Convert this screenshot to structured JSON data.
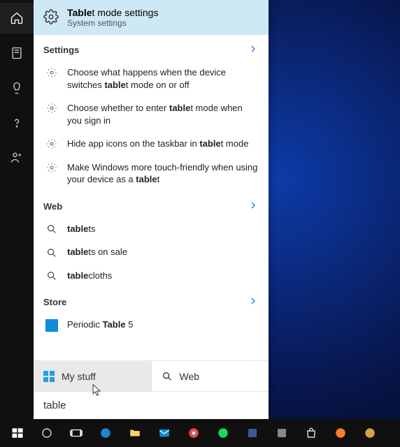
{
  "query": "table",
  "best_match": {
    "title_pre": "Table",
    "title_post": "t mode settings",
    "subtitle": "System settings"
  },
  "sections": {
    "settings": {
      "label": "Settings",
      "items": [
        {
          "pre": "Choose what happens when the device switches ",
          "bold": "table",
          "post": "t mode on or off"
        },
        {
          "pre": "Choose whether to enter ",
          "bold": "table",
          "post": "t mode when you sign in"
        },
        {
          "pre": "Hide app icons on the taskbar in ",
          "bold": "table",
          "post": "t mode"
        },
        {
          "pre": "Make Windows more touch-friendly when using your device as a ",
          "bold": "table",
          "post": "t"
        }
      ]
    },
    "web": {
      "label": "Web",
      "items": [
        {
          "bold": "table",
          "post": "ts"
        },
        {
          "bold": "table",
          "post": "ts on sale"
        },
        {
          "bold": "table",
          "post": "cloths"
        }
      ]
    },
    "store": {
      "label": "Store",
      "items": [
        {
          "pre": "Periodic ",
          "bold": "Table",
          "post": " 5"
        }
      ]
    }
  },
  "filters": {
    "mystuff": "My stuff",
    "web": "Web"
  }
}
